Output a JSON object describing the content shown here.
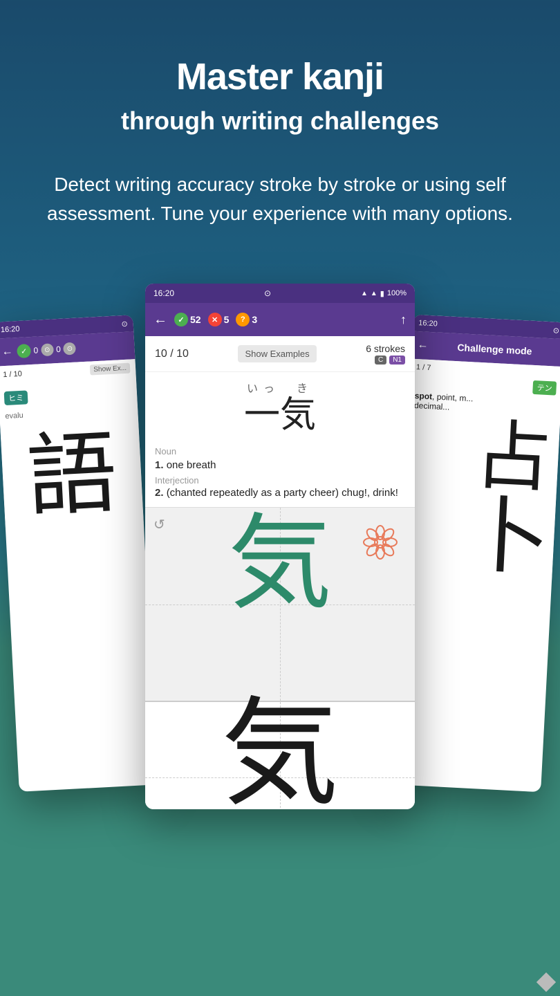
{
  "hero": {
    "title": "Master kanji",
    "subtitle": "through writing challenges",
    "description": "Detect writing accuracy stroke by stroke or using self assessment. Tune your experience with many options."
  },
  "center_phone": {
    "status_time": "16:20",
    "status_battery": "100%",
    "score_correct": "52",
    "score_wrong": "5",
    "score_pending": "3",
    "progress": "10 / 10",
    "show_examples_label": "Show Examples",
    "strokes_label": "6 strokes",
    "badge_c": "C",
    "badge_n1": "N1",
    "kanji_reading": "いっ　き",
    "kanji_char": "一気",
    "pos_noun": "Noun",
    "def_1_num": "1.",
    "def_1_text": "one breath",
    "pos_interjection": "Interjection",
    "def_2_num": "2.",
    "def_2_text": "(chanted repeatedly as a party cheer) chug!, drink!",
    "kanji_stroke": "気"
  },
  "left_phone": {
    "status_time": "16:20",
    "progress": "1 / 10",
    "show_examples_label": "Show Ex...",
    "hiragana_label": "ヒミ",
    "eval_text": "evalu"
  },
  "right_phone": {
    "status_time": "16:20",
    "appbar_title": "Challenge mode",
    "progress": "1 / 7",
    "word_label": "テン",
    "definition": "spot, point, m... decimal..."
  },
  "icons": {
    "back_arrow": "←",
    "filter": "↑",
    "refresh": "↺",
    "info": "ⓘ",
    "star": "★",
    "wifi": "▲",
    "signal": "▲"
  }
}
